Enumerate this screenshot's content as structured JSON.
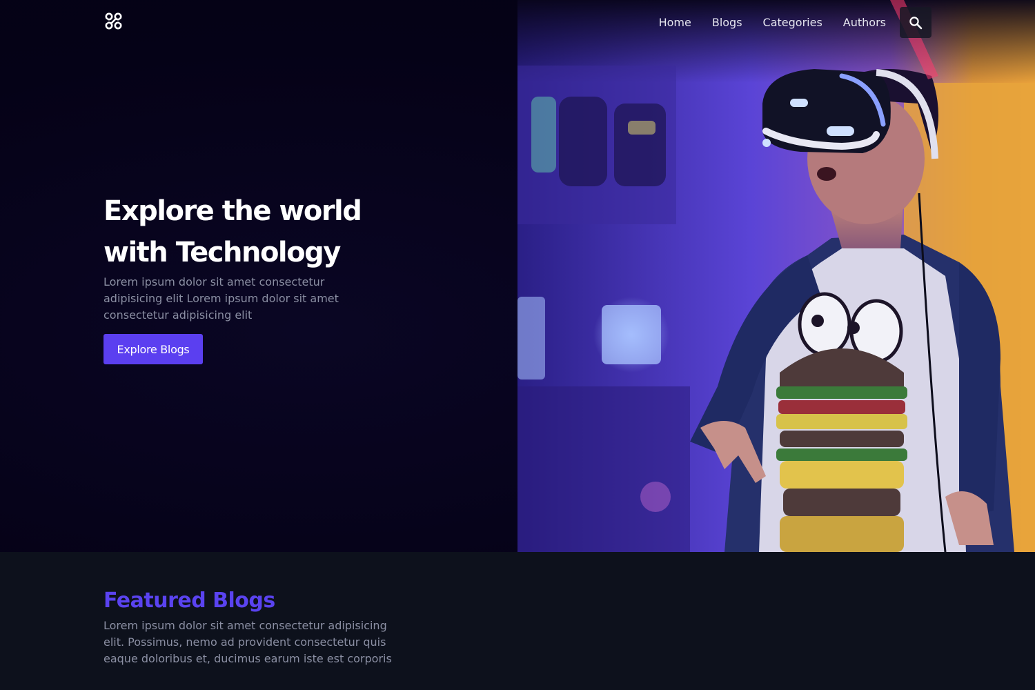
{
  "nav": {
    "items": [
      {
        "label": "Home"
      },
      {
        "label": "Blogs"
      },
      {
        "label": "Categories"
      },
      {
        "label": "Authors"
      }
    ],
    "search_icon": "search-icon"
  },
  "logo": {
    "icon": "brand-logo-icon"
  },
  "hero": {
    "title": "Explore the world with Technology",
    "subtitle": "Lorem ipsum dolor sit amet consectetur adipisicing elit Lorem ipsum dolor sit amet consectetur adipisicing elit",
    "cta_label": "Explore Blogs",
    "image": "person-wearing-vr-headset-photo"
  },
  "featured": {
    "title": "Featured Blogs",
    "subtitle": "Lorem ipsum dolor sit amet consectetur adipisicing elit. Possimus, nemo ad provident consectetur quis eaque doloribus et, ducimus earum iste est corporis"
  },
  "colors": {
    "accent": "#5b3ff0",
    "hero_bg": "#050217",
    "section_bg": "#0d111c",
    "muted_text": "#8b8fa3"
  }
}
